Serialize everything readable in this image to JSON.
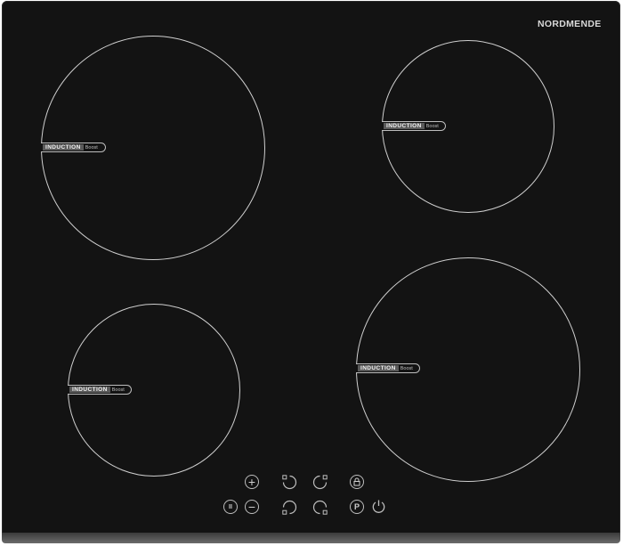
{
  "brand": "NORDMENDE",
  "zones": [
    {
      "name": "zone-top-left",
      "badge": "INDUCTION",
      "boost": "Boost"
    },
    {
      "name": "zone-top-right",
      "badge": "INDUCTION",
      "boost": "Boost"
    },
    {
      "name": "zone-bottom-left",
      "badge": "INDUCTION",
      "boost": "Boost"
    },
    {
      "name": "zone-bottom-right",
      "badge": "INDUCTION",
      "boost": "Boost"
    }
  ],
  "controls": {
    "plus": "+",
    "minus": "−",
    "pause": "II",
    "program": "P"
  },
  "colors": {
    "glass": "#131313",
    "ring": "#cfcfcf",
    "badge": "#5a5a5a"
  }
}
